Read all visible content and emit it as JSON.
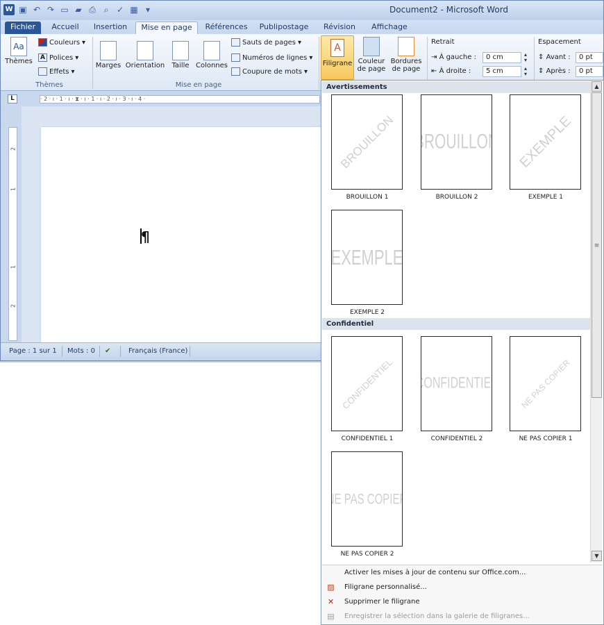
{
  "window": {
    "title": "Document2 - Microsoft Word"
  },
  "tabs": [
    {
      "label": "Fichier"
    },
    {
      "label": "Accueil"
    },
    {
      "label": "Insertion"
    },
    {
      "label": "Mise en page"
    },
    {
      "label": "Références"
    },
    {
      "label": "Publipostage"
    },
    {
      "label": "Révision"
    },
    {
      "label": "Affichage"
    }
  ],
  "ribbon": {
    "themes": {
      "button": "Thèmes",
      "colors": "Couleurs",
      "fonts": "Polices",
      "effects": "Effets",
      "group": "Thèmes"
    },
    "page_setup": {
      "margins": "Marges",
      "orientation": "Orientation",
      "size": "Taille",
      "columns": "Colonnes",
      "breaks": "Sauts de pages",
      "line_numbers": "Numéros de lignes",
      "hyphenation": "Coupure de mots",
      "group": "Mise en page"
    },
    "background": {
      "watermark": "Filigrane",
      "page_color_1": "Couleur",
      "page_color_2": "de page",
      "borders_1": "Bordures",
      "borders_2": "de page"
    },
    "indent": {
      "title": "Retrait",
      "left_label": "À gauche :",
      "left_value": "0 cm",
      "right_label": "À droite :",
      "right_value": "5 cm"
    },
    "spacing": {
      "title": "Espacement",
      "before_label": "Avant :",
      "before_value": "0 pt",
      "after_label": "Après :",
      "after_value": "0 pt"
    }
  },
  "ruler": {
    "marks": "· 2 · ı · 1 · ı · ⧗ · ı · 1 · ı · 2 · ı · 3 · ı · 4 ·"
  },
  "document": {
    "pilcrow": "¶"
  },
  "status": {
    "page": "Page : 1 sur 1",
    "words": "Mots : 0",
    "language": "Français (France)"
  },
  "gallery": {
    "sections": [
      {
        "title": "Avertissements",
        "items": [
          {
            "label": "BROUILLON 1",
            "watermark": "BROUILLON",
            "diagonal": true
          },
          {
            "label": "BROUILLON 2",
            "watermark": "BROUILLON",
            "diagonal": false
          },
          {
            "label": "EXEMPLE 1",
            "watermark": "EXEMPLE",
            "diagonal": true
          },
          {
            "label": "EXEMPLE 2",
            "watermark": "EXEMPLE",
            "diagonal": false
          }
        ]
      },
      {
        "title": "Confidentiel",
        "items": [
          {
            "label": "CONFIDENTIEL 1",
            "watermark": "CONFIDENTIEL",
            "diagonal": true
          },
          {
            "label": "CONFIDENTIEL 2",
            "watermark": "CONFIDENTIEL",
            "diagonal": false
          },
          {
            "label": "NE PAS COPIER 1",
            "watermark": "NE PAS COPIER",
            "diagonal": true
          },
          {
            "label": "NE PAS COPIER 2",
            "watermark": "NE PAS COPIER",
            "diagonal": false
          }
        ]
      }
    ],
    "menu": [
      {
        "label": "Activer les mises à jour de contenu sur Office.com...",
        "icon": "none",
        "enabled": true
      },
      {
        "label": "Filigrane personnalisé...",
        "icon": "watermark-icon",
        "enabled": true
      },
      {
        "label": "Supprimer le filigrane",
        "icon": "remove-watermark-icon",
        "enabled": true
      },
      {
        "label": "Enregistrer la sélection dans la galerie de filigranes...",
        "icon": "save-gallery-icon",
        "enabled": false
      }
    ]
  },
  "colors": {
    "file_tab": "#2a5597",
    "watermark_gray": "#d0d0d0",
    "highlight": "#f8c860"
  }
}
